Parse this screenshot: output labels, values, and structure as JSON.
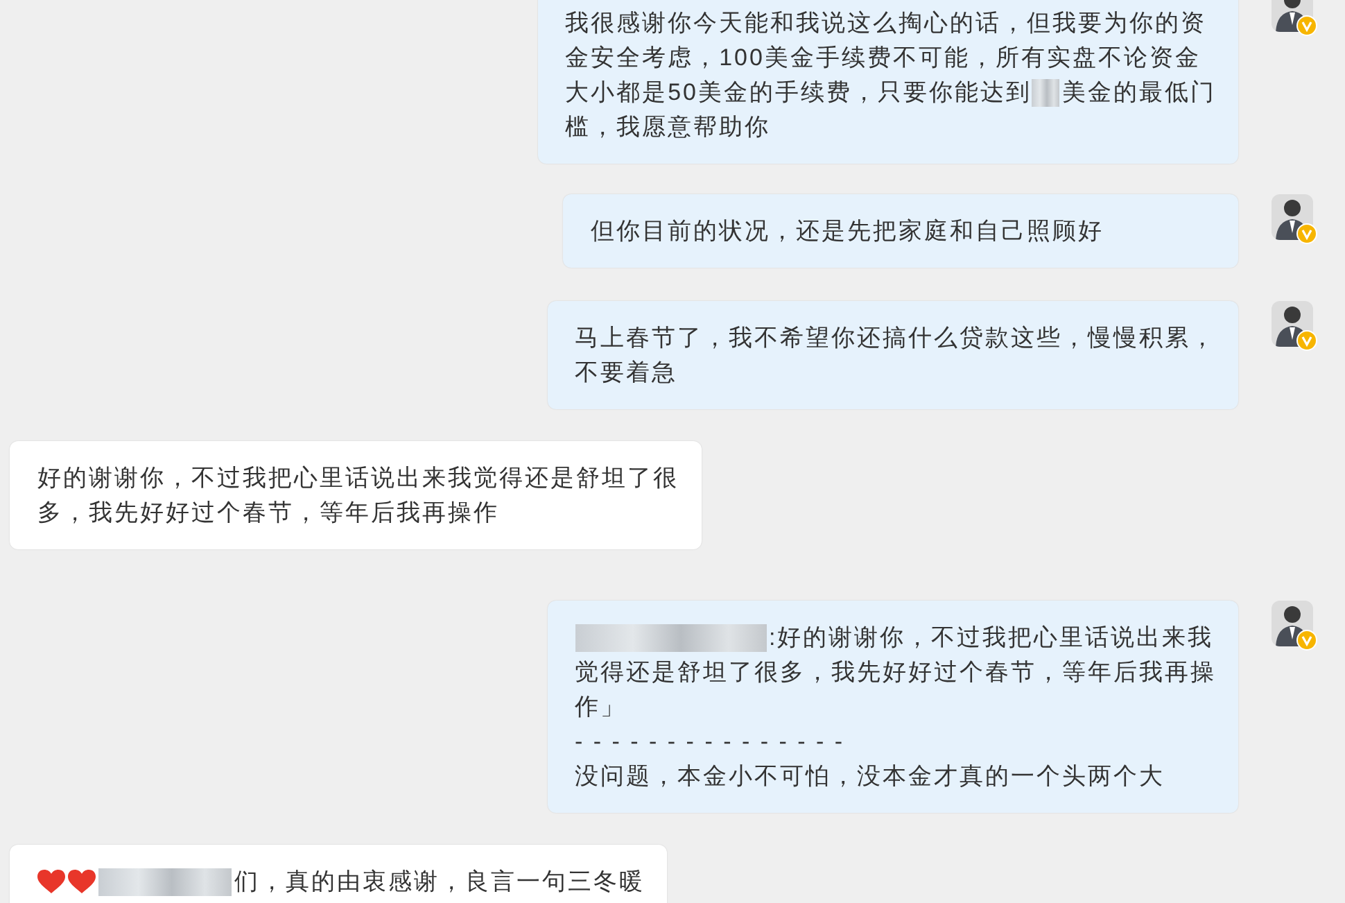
{
  "messages": [
    {
      "kind": "outgoing",
      "lines": [
        [
          {
            "kind": "text",
            "text": "我很感谢你今天能和我说这么掏心的话，但我要为你的资"
          }
        ],
        [
          {
            "kind": "text",
            "text": "金安全考虑，100美金手续费不可能，所有实盘不论资金"
          }
        ],
        [
          {
            "kind": "text",
            "text": "大小都是50美金的手续费，只要你能达到"
          },
          {
            "kind": "redacted_short"
          },
          {
            "kind": "text",
            "text": "美金的最低门"
          }
        ],
        [
          {
            "kind": "text",
            "text": "槛，我愿意帮助你"
          }
        ]
      ]
    },
    {
      "kind": "outgoing",
      "lines": [
        [
          {
            "kind": "text",
            "text": "但你目前的状况，还是先把家庭和自己照顾好"
          }
        ]
      ]
    },
    {
      "kind": "outgoing",
      "lines": [
        [
          {
            "kind": "text",
            "text": "马上春节了，我不希望你还搞什么贷款这些，慢慢积累，"
          }
        ],
        [
          {
            "kind": "text",
            "text": "不要着急"
          }
        ]
      ]
    },
    {
      "kind": "incoming",
      "lines": [
        [
          {
            "kind": "text",
            "text": "好的谢谢你，不过我把心里话说出来我觉得还是舒坦了很"
          }
        ],
        [
          {
            "kind": "text",
            "text": "多，我先好好过个春节，等年后我再操作"
          }
        ]
      ]
    },
    {
      "kind": "outgoing",
      "lines": [
        [
          {
            "kind": "redacted_long"
          },
          {
            "kind": "text",
            "text": ":好的谢谢你，不过我把心里话说出来我"
          }
        ],
        [
          {
            "kind": "text",
            "text": "觉得还是舒坦了很多，我先好好过个春节，等年后我再操"
          }
        ],
        [
          {
            "kind": "text",
            "text": "作」"
          }
        ],
        [
          {
            "kind": "text",
            "text": "- - - - - - - - - - - - - - -"
          }
        ],
        [
          {
            "kind": "text",
            "text": "没问题，本金小不可怕，没本金才真的一个头两个大"
          }
        ]
      ]
    },
    {
      "kind": "incoming",
      "lines": [
        [
          {
            "kind": "heart"
          },
          {
            "kind": "heart"
          },
          {
            "kind": "redacted_medium"
          },
          {
            "kind": "text",
            "text": "们，真的由衷感谢，良言一句三冬暖"
          }
        ]
      ]
    }
  ]
}
